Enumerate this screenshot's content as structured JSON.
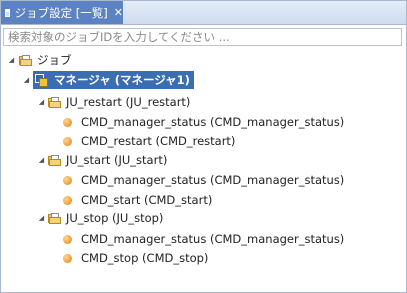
{
  "tab": {
    "label": "ジョブ設定 [一覧]",
    "close": "✕"
  },
  "search": {
    "placeholder": "検索対象のジョブIDを入力してください ..."
  },
  "tree": {
    "root": "ジョブ",
    "manager": "マネージャ (マネージャ1)",
    "units": [
      {
        "label": "JU_restart (JU_restart)",
        "jobs": [
          "CMD_manager_status (CMD_manager_status)",
          "CMD_restart (CMD_restart)"
        ]
      },
      {
        "label": "JU_start (JU_start)",
        "jobs": [
          "CMD_manager_status (CMD_manager_status)",
          "CMD_start (CMD_start)"
        ]
      },
      {
        "label": "JU_stop (JU_stop)",
        "jobs": [
          "CMD_manager_status (CMD_manager_status)",
          "CMD_stop (CMD_stop)"
        ]
      }
    ]
  },
  "colors": {
    "tab_active": "#5b83c4",
    "selection": "#3b6db2",
    "job_folder": "#e9c25a",
    "job_node": "#f0a13a"
  },
  "icons": {
    "root": "job-folder-icon",
    "manager": "manager-icon",
    "unit": "job-folder-icon",
    "job": "command-job-icon"
  }
}
